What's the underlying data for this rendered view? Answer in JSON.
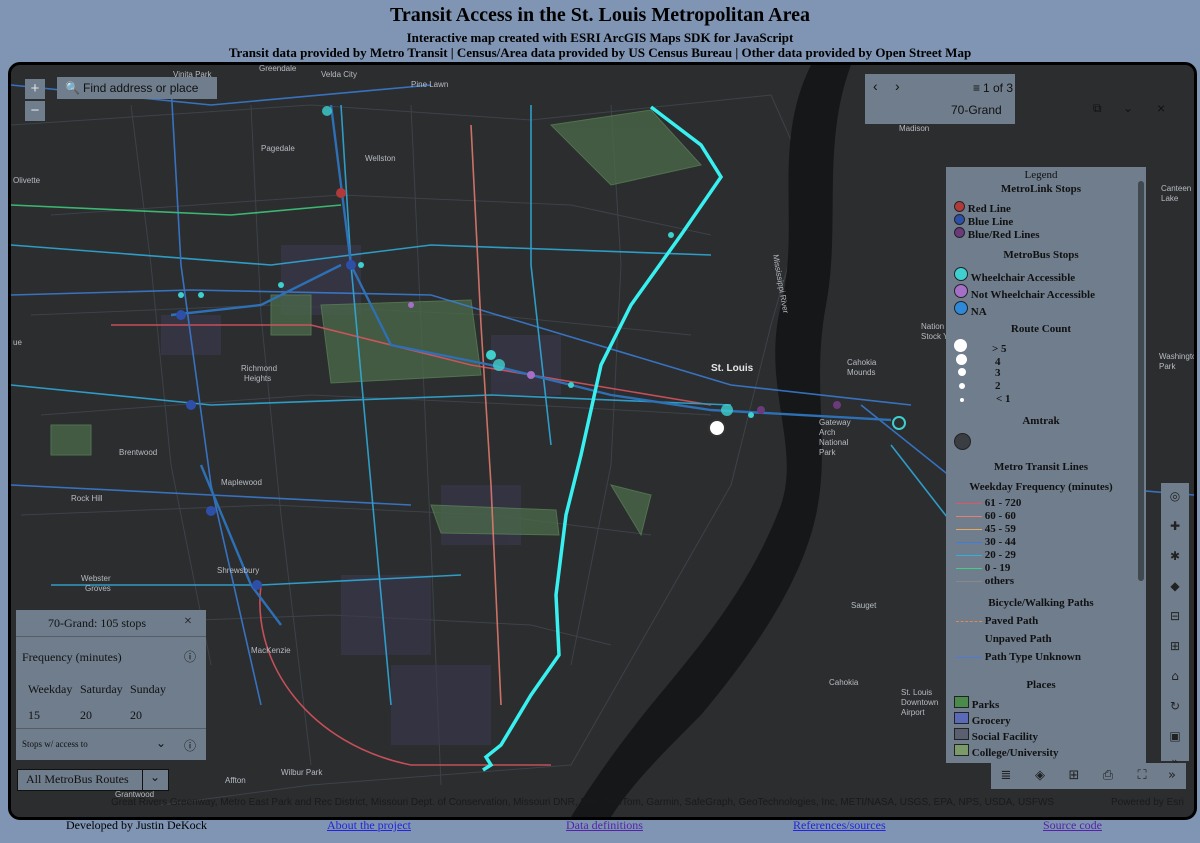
{
  "header": {
    "title": "Transit Access in the St. Louis Metropolitan Area",
    "subtitle": "Interactive map created with ESRI ArcGIS Maps SDK for JavaScript",
    "credits": "Transit data provided by Metro Transit | Census/Area data provided by US Census Bureau | Other data provided by Open Street Map"
  },
  "map": {
    "zoom_in": "+",
    "zoom_out": "−",
    "search_placeholder": "Find address or place",
    "place_labels": [
      "Vinita Park",
      "Velda City",
      "Pine Lawn",
      "Pagedale",
      "Wellston",
      "Olivette",
      "Madison",
      "Richmond Heights",
      "St. Louis",
      "Brentwood",
      "Maplewood",
      "Rock Hill",
      "Webster Groves",
      "Shrewsbury",
      "MacKenzie",
      "Affton",
      "Wilbur Park",
      "Grantwood Village",
      "Sauget",
      "Cahokia",
      "Gateway Arch National Park",
      "Mississippi River",
      "Canteen Lake",
      "Washington Park",
      "National Stock Yards",
      "Cahokia Mounds",
      "St. Louis Downtown Airport",
      "Greendale",
      "ue"
    ],
    "attribution": "Great Rivers Greenway, Metro East Park and Rec District, Missouri Dept. of Conservation, Missouri DNR, Esri, TomTom, Garmin, SafeGraph, GeoTechnologies, Inc, METI/NASA, USGS, EPA, NPS, USDA, USFWS",
    "powered_by": "Powered by Esri",
    "colors": {
      "route": "#39f0f0",
      "red_line": "#c43a3a",
      "blue_line": "#2e4fb5",
      "bus_access": "#3fd5d5",
      "bus_no_access": "#9a5fbf"
    }
  },
  "popup": {
    "counter": "1 of 3",
    "title": "70-Grand",
    "prev": "‹",
    "next": "›",
    "dock_icon": "dock-icon",
    "collapse_icon": "chevron-down-icon",
    "close": "×"
  },
  "legend": {
    "title": "Legend",
    "metrolink_header": "MetroLink Stops",
    "metrolink": [
      {
        "label": "Red Line",
        "color": "#b03a3a"
      },
      {
        "label": "Blue Line",
        "color": "#2d4fa8"
      },
      {
        "label": "Blue/Red Lines",
        "color": "#6a3a7a"
      }
    ],
    "metrobus_header": "MetroBus Stops",
    "metrobus": [
      {
        "label": "Wheelchair Accessible",
        "color": "#3fcfcf"
      },
      {
        "label": "Not Wheelchair Accessible",
        "color": "#a56fc7"
      },
      {
        "label": "NA",
        "color": "#2f88d8"
      }
    ],
    "route_count_header": "Route Count",
    "route_count": [
      "> 5",
      "4",
      "3",
      "2",
      "< 1"
    ],
    "amtrak_header": "Amtrak",
    "lines_header": "Metro Transit Lines",
    "weekday_header": "Weekday Frequency (minutes)",
    "weekday": [
      {
        "label": "61 - 720",
        "color": "#e05560"
      },
      {
        "label": "60 - 60",
        "color": "#e87e70"
      },
      {
        "label": "45 - 59",
        "color": "#e8a860"
      },
      {
        "label": "30 - 44",
        "color": "#3b7fd8"
      },
      {
        "label": "20 - 29",
        "color": "#2fb0e0"
      },
      {
        "label": "0 - 19",
        "color": "#3fd080"
      },
      {
        "label": "others",
        "color": "#888888"
      }
    ],
    "paths_header": "Bicycle/Walking Paths",
    "paths": [
      {
        "label": "Paved Path",
        "color": "#e08a50"
      },
      {
        "label": "Unpaved Path",
        "color": "#6f7d8c"
      },
      {
        "label": "Path Type Unknown",
        "color": "#5078d8"
      }
    ],
    "places_header": "Places",
    "places": [
      {
        "label": "Parks",
        "color": "#4a8a4a"
      },
      {
        "label": "Grocery",
        "color": "#5a6ab8"
      },
      {
        "label": "Social Facility",
        "color": "#5a6070"
      },
      {
        "label": "College/University",
        "color": "#7a9a6a"
      }
    ]
  },
  "stops_panel": {
    "title": "70-Grand: 105 stops",
    "close": "×",
    "freq_label": "Frequency (minutes)",
    "info_icon": "ⓘ",
    "days": [
      "Weekday",
      "Saturday",
      "Sunday"
    ],
    "values": [
      "15",
      "20",
      "20"
    ],
    "access_label": "Stops w/ access to",
    "expand": "⌄"
  },
  "route_select": {
    "value": "All MetroBus Routes",
    "arrow": "⌄"
  },
  "footer": {
    "author": "Developed by Justin DeKock",
    "links": [
      "About the project",
      "Data definitions",
      "References/sources",
      "Source code"
    ]
  }
}
